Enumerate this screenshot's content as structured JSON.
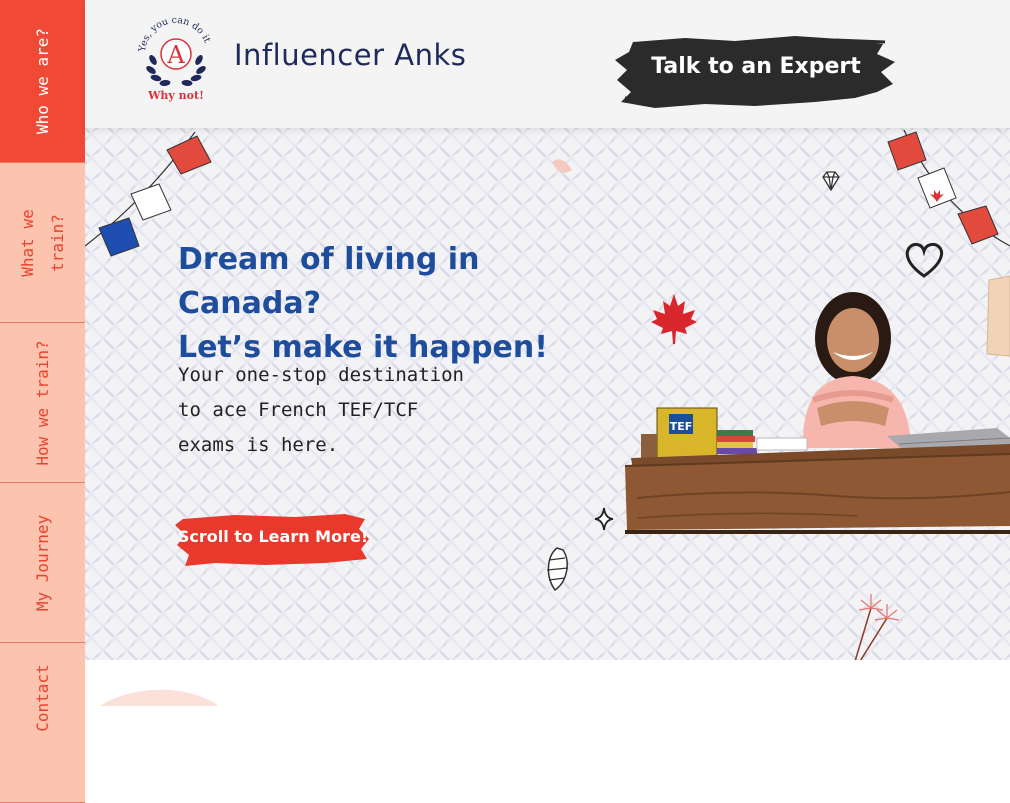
{
  "nav": {
    "items": [
      {
        "label": "Who we are?",
        "active": true
      },
      {
        "label": "What we train?",
        "active": false
      },
      {
        "label": "How we train?",
        "active": false
      },
      {
        "label": "My Journey",
        "active": false
      },
      {
        "label": "Contact",
        "active": false
      }
    ]
  },
  "header": {
    "logo": {
      "arc_text": "Yes, you can do it",
      "letter": "A",
      "tagline": "Why not!"
    },
    "brand": "Influencer Anks",
    "cta_label": "Talk to an Expert"
  },
  "hero": {
    "headline_line1": "Dream of living in Canada?",
    "headline_line2": "Let’s make it happen!",
    "subtext": "Your one-stop destination to ace French TEF/TCF exams is here.",
    "button_label": "Scroll to Learn More!",
    "book_label": "TEF"
  },
  "colors": {
    "nav_active": "#f04a36",
    "nav_inactive": "#fcc3ae",
    "headline": "#1d4d9c",
    "cta_brush": "#2b2b2b",
    "button_brush": "#e8392c"
  },
  "icons": [
    "bunting-icon",
    "maple-leaf-icon",
    "diamond-icon",
    "heart-icon",
    "sparkle-icon",
    "croissant-icon",
    "sparkler-icon"
  ]
}
